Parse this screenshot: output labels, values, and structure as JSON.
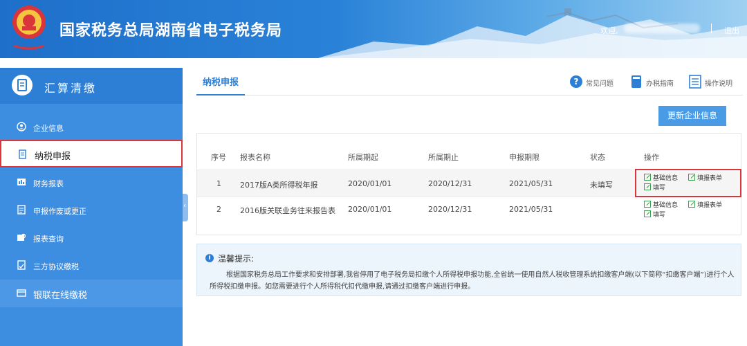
{
  "header": {
    "site_title": "国家税务总局湖南省电子税务局",
    "welcome": "欢迎,",
    "logout": "退出"
  },
  "sidebar": {
    "title": "汇算清缴",
    "items": [
      {
        "label": "企业信息",
        "icon": "user-circle-icon"
      },
      {
        "label": "纳税申报",
        "icon": "document-edit-icon",
        "active": true
      },
      {
        "label": "财务报表",
        "icon": "report-icon"
      },
      {
        "label": "申报作废或更正",
        "icon": "list-icon"
      },
      {
        "label": "报表查询",
        "icon": "search-report-icon"
      },
      {
        "label": "三方协议缴税",
        "icon": "agreement-icon"
      },
      {
        "label": "银联在线缴税",
        "icon": "payment-icon"
      }
    ]
  },
  "tabs": {
    "active": "纳税申报"
  },
  "toolbar": {
    "faq": "常见问题",
    "guide": "办税指南",
    "manual": "操作说明"
  },
  "update_button": "更新企业信息",
  "table": {
    "headers": [
      "序号",
      "报表名称",
      "所属期起",
      "所属期止",
      "申报期限",
      "状态",
      "操作"
    ],
    "rows": [
      {
        "no": "1",
        "name": "2017版A类所得税年报",
        "start": "2020/01/01",
        "end": "2020/12/31",
        "deadline": "2021/05/31",
        "status": "未填写"
      },
      {
        "no": "2",
        "name": "2016版关联业务往来报告表",
        "start": "2020/01/01",
        "end": "2020/12/31",
        "deadline": "2021/05/31",
        "status": ""
      }
    ],
    "ops": {
      "basic_info": "基础信息",
      "fill_form": "填报表单",
      "fill": "填写"
    }
  },
  "tips": {
    "title": "温馨提示:",
    "text": "根据国家税务总局工作要求和安排部署,我省停用了电子税务局扣缴个人所得税申报功能,全省统一使用自然人税收管理系统扣缴客户端(以下简称“扣缴客户端”)进行个人所得税扣缴申报。如您需要进行个人所得税代扣代缴申报,请通过扣缴客户端进行申报。"
  },
  "colors": {
    "brand_blue": "#2d7fd6",
    "highlight_red": "#d9353a",
    "button_blue": "#4a9be6"
  }
}
